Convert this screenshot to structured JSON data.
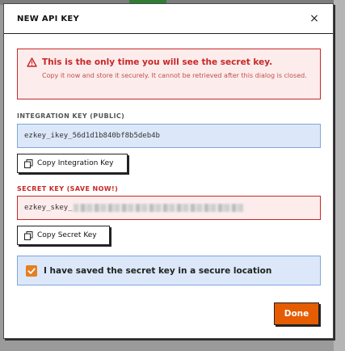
{
  "dialog": {
    "title": "NEW API KEY",
    "close_label": "×"
  },
  "alert": {
    "icon": "warning-icon",
    "title": "This is the only time you will see the secret key.",
    "body": "Copy it now and store it securely. It cannot be retrieved after this dialog is closed."
  },
  "integration": {
    "label": "INTEGRATION KEY (PUBLIC)",
    "value": "ezkey_ikey_56d1d1b840bf8b5deb4b",
    "copy_label": "Copy Integration Key"
  },
  "secret": {
    "label": "SECRET KEY (SAVE NOW!)",
    "value_prefix": "ezkey_skey_",
    "copy_label": "Copy Secret Key"
  },
  "confirm": {
    "checked": true,
    "label": "I have saved the secret key in a secure location"
  },
  "done_label": "Done",
  "colors": {
    "danger": "#c62828",
    "accent": "#e65c00",
    "info_bg": "#dce8f9"
  }
}
